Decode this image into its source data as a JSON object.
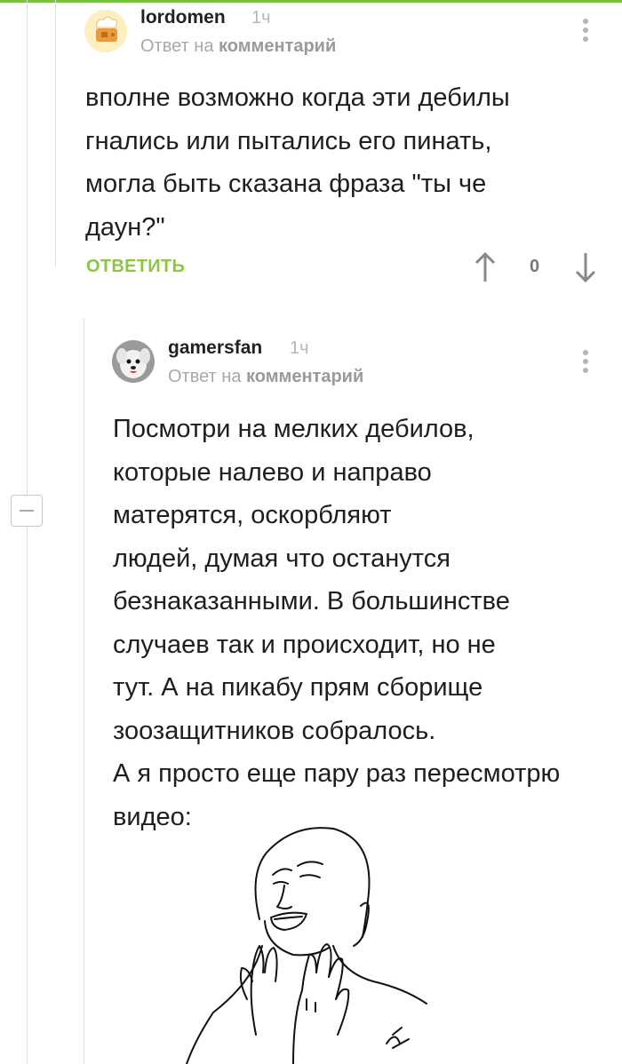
{
  "comment1": {
    "username": "lordomen",
    "time": "1ч",
    "reply_prefix": "Ответ на",
    "reply_target": "комментарий",
    "text": "вполне возможно когда эти дебилы\nгнались или пытались его пинать,\nмогла быть сказана фраза \"ты че\nдаун?\"",
    "reply_label": "ОТВЕТИТЬ",
    "score": "0"
  },
  "comment2": {
    "username": "gamersfan",
    "time": "1ч",
    "reply_prefix": "Ответ на",
    "reply_target": "комментарий",
    "text": "Посмотри на мелких дебилов,\nкоторые налево и направо\nматерятся, оскорбляют\nлюдей, думая что останутся\nбезнаказанными. В большинстве\nслучаев так и происходит, но не\nтут. А на пикабу прям сборище\nзоозащитников собралось.\nА я просто еще пару раз пересмотрю\nвидео:"
  },
  "colors": {
    "accent": "#8dc63f",
    "meta": "#a8a8a8"
  }
}
